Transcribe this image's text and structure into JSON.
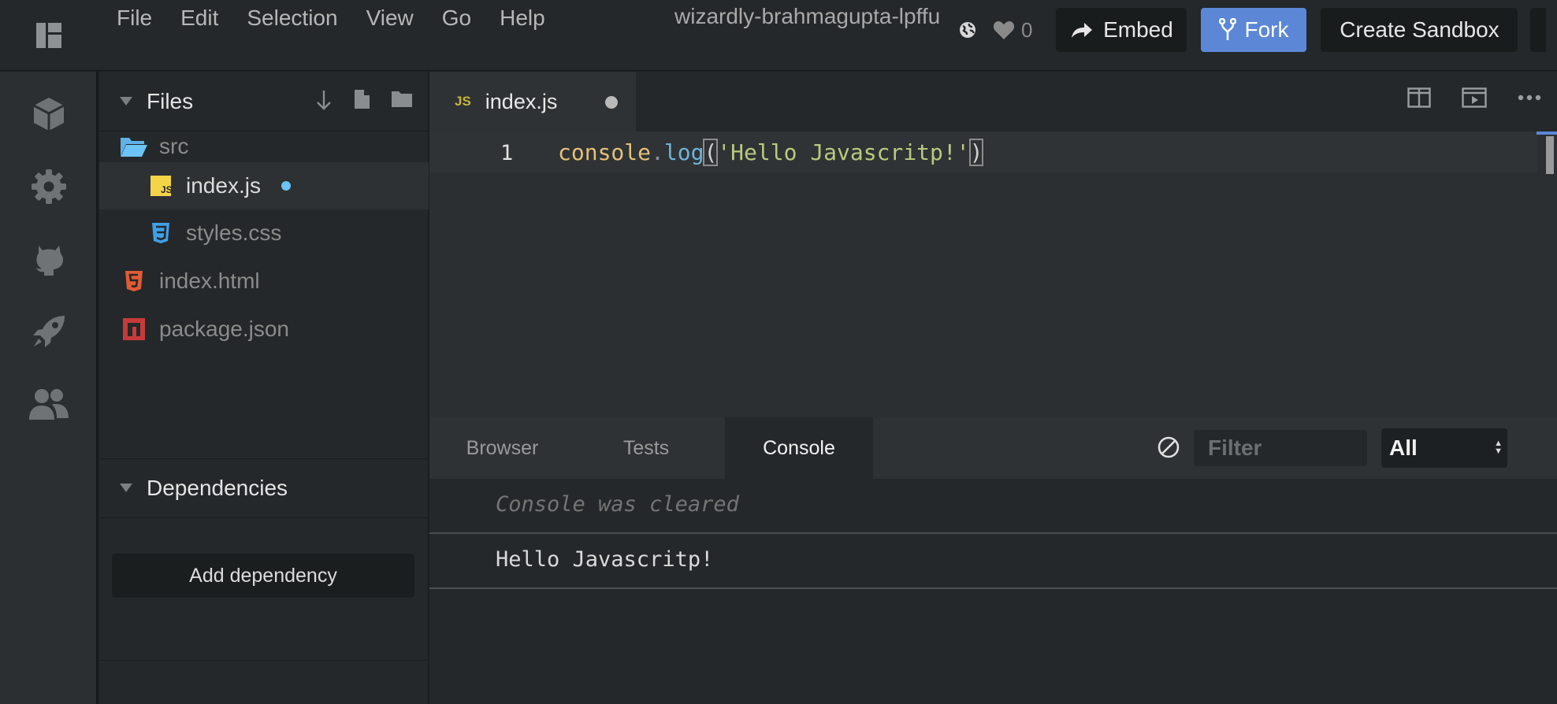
{
  "menubar": {
    "items": [
      "File",
      "Edit",
      "Selection",
      "View",
      "Go",
      "Help"
    ],
    "sandbox_name": "wizardly-brahmagupta-lpffu",
    "likes": "0",
    "embed_label": "Embed",
    "fork_label": "Fork",
    "create_label": "Create Sandbox"
  },
  "rail": {
    "icons": [
      "cube-icon",
      "gear-icon",
      "github-icon",
      "rocket-icon",
      "users-icon"
    ]
  },
  "files_panel": {
    "title": "Files",
    "tree": [
      {
        "name": "src",
        "type": "folder"
      },
      {
        "name": "index.js",
        "type": "js",
        "modified": true
      },
      {
        "name": "styles.css",
        "type": "css"
      },
      {
        "name": "index.html",
        "type": "html"
      },
      {
        "name": "package.json",
        "type": "npm"
      }
    ]
  },
  "dependencies": {
    "title": "Dependencies",
    "add_label": "Add dependency"
  },
  "editor": {
    "tab_badge": "JS",
    "tab_label": "index.js",
    "line_number": "1",
    "code": {
      "object": "console",
      "dot": ".",
      "method": "log",
      "open": "(",
      "string": "'Hello Javascritp!'",
      "close": ")"
    }
  },
  "bottom_panel": {
    "tabs": [
      "Browser",
      "Tests",
      "Console"
    ],
    "active_tab": "Console",
    "filter_placeholder": "Filter",
    "level_select": "All"
  },
  "console": {
    "lines": [
      "Console was cleared",
      "Hello Javascritp!"
    ]
  },
  "colors": {
    "accent": "#5b87d6",
    "modified_dot": "#6cc3f5",
    "js_yellow": "#f5d547",
    "css_blue": "#3fa1e8",
    "html_orange": "#e15b34",
    "npm_red": "#c83a3a"
  }
}
